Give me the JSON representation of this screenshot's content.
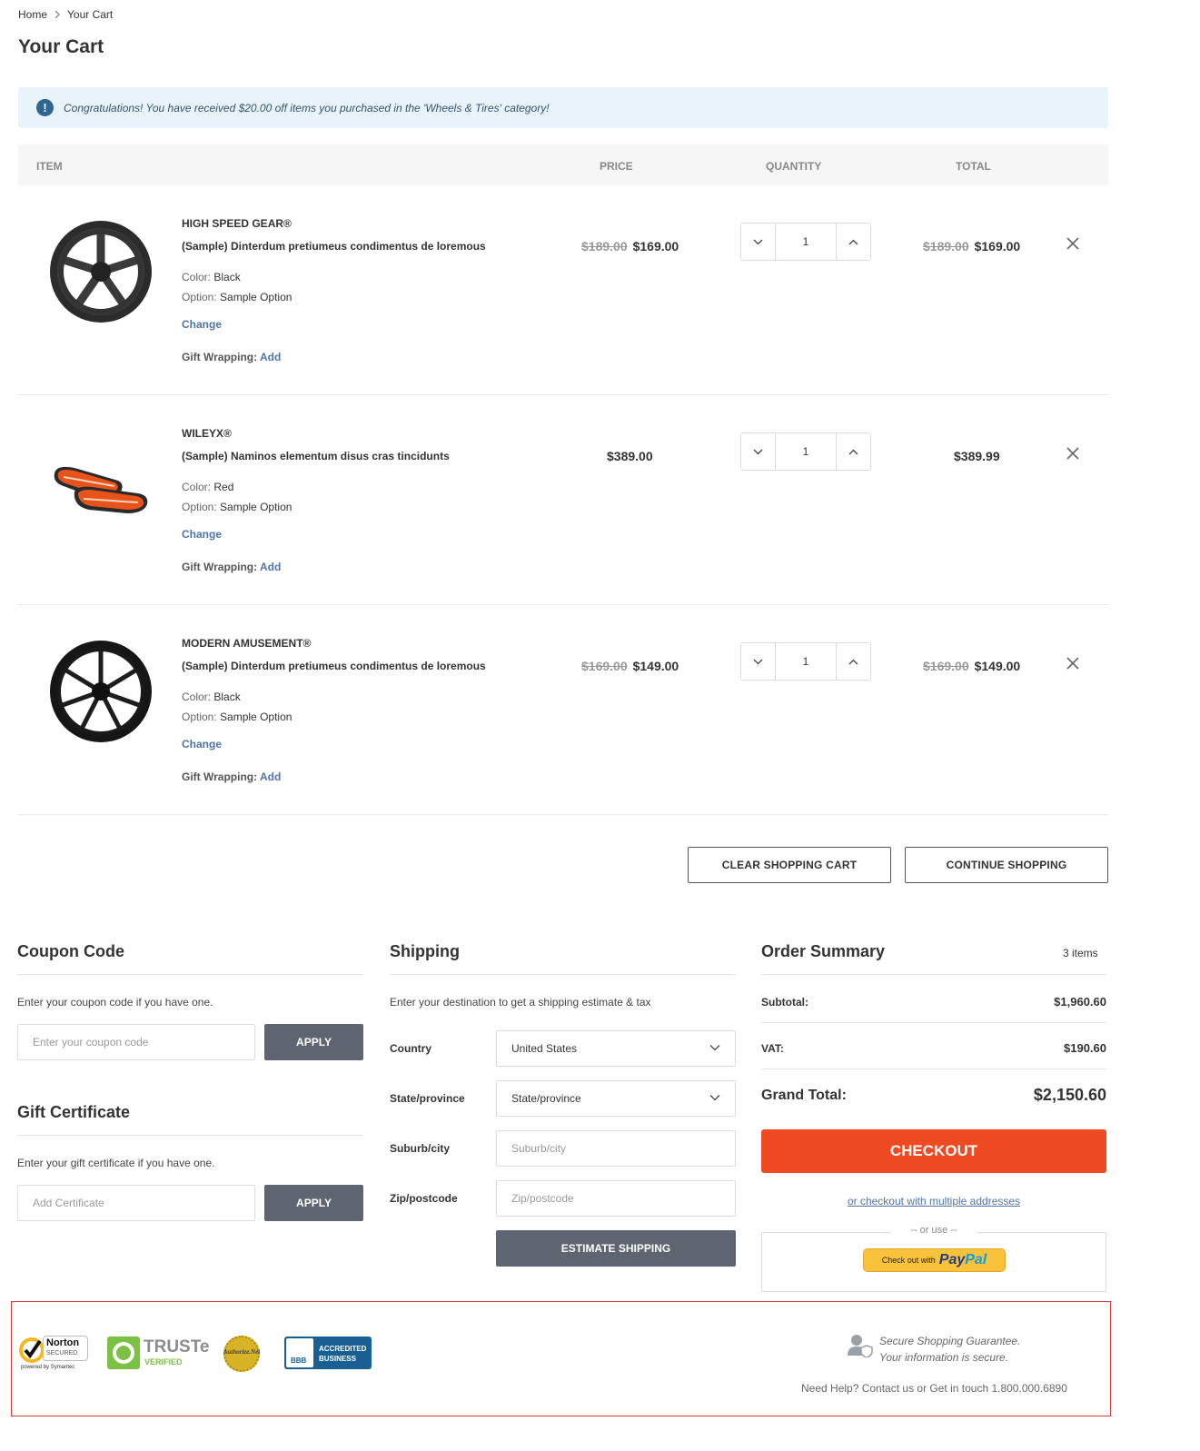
{
  "breadcrumb": {
    "home": "Home",
    "current": "Your Cart"
  },
  "page_title": "Your Cart",
  "alert": {
    "text": "Congratulations! You have received $20.00 off items you purchased in the 'Wheels & Tires' category!"
  },
  "table_headers": {
    "item": "ITEM",
    "price": "PRICE",
    "quantity": "QUANTITY",
    "total": "TOTAL"
  },
  "items": [
    {
      "brand": "HIGH SPEED GEAR®",
      "name": "(Sample) Dinterdum pretiumeus condimentus de loremous",
      "color_label": "Color:",
      "color": "Black",
      "option_label": "Option:",
      "option": "Sample Option",
      "change": "Change",
      "gift_label": "Gift Wrapping:",
      "gift_action": "Add",
      "price_old": "$189.00",
      "price": "$169.00",
      "qty": "1",
      "total_old": "$189.00",
      "total": "$169.00"
    },
    {
      "brand": "WILEYX®",
      "name": "(Sample) Naminos elementum disus cras tincidunts",
      "color_label": "Color:",
      "color": "Red",
      "option_label": "Option:",
      "option": "Sample Option",
      "change": "Change",
      "gift_label": "Gift Wrapping:",
      "gift_action": "Add",
      "price_old": "",
      "price": "$389.00",
      "qty": "1",
      "total_old": "",
      "total": "$389.99"
    },
    {
      "brand": "MODERN AMUSEMENT®",
      "name": "(Sample) Dinterdum pretiumeus condimentus de loremous",
      "color_label": "Color:",
      "color": "Black",
      "option_label": "Option:",
      "option": "Sample Option",
      "change": "Change",
      "gift_label": "Gift Wrapping:",
      "gift_action": "Add",
      "price_old": "$169.00",
      "price": "$149.00",
      "qty": "1",
      "total_old": "$169.00",
      "total": "$149.00"
    }
  ],
  "actions": {
    "clear": "CLEAR SHOPPING CART",
    "continue": "CONTINUE SHOPPING"
  },
  "coupon": {
    "title": "Coupon Code",
    "text": "Enter your coupon code if you have one.",
    "placeholder": "Enter your coupon code",
    "apply": "APPLY"
  },
  "gift_cert": {
    "title": "Gift Certificate",
    "text": "Enter your gift certificate if you have one.",
    "placeholder": "Add Certificate",
    "apply": "APPLY"
  },
  "shipping": {
    "title": "Shipping",
    "text": "Enter your destination to get a shipping estimate & tax",
    "country_label": "Country",
    "country_value": "United States",
    "state_label": "State/province",
    "state_value": "State/province",
    "city_label": "Suburb/city",
    "city_placeholder": "Suburb/city",
    "zip_label": "Zip/postcode",
    "zip_placeholder": "Zip/postcode",
    "estimate": "ESTIMATE SHIPPING"
  },
  "summary": {
    "title": "Order Summary",
    "count": "3 items",
    "subtotal_label": "Subtotal:",
    "subtotal": "$1,960.60",
    "vat_label": "VAT:",
    "vat": "$190.60",
    "grand_label": "Grand Total:",
    "grand": "$2,150.60",
    "checkout": "CHECKOUT",
    "multi": "or checkout with multiple addresses",
    "or_use": "-- or use --",
    "paypal_pre": "Check out with",
    "paypal_pay": "Pay",
    "paypal_pal": "Pal"
  },
  "trust": {
    "norton": "Norton",
    "norton_sub": "SECURED",
    "norton_powered": "powered by Symantec",
    "truste": "TRUSTe",
    "truste_sub": "VERIFIED",
    "authnet": "Authorize.Net",
    "bbb": "BBB",
    "bbb_line1": "ACCREDITED",
    "bbb_line2": "BUSINESS",
    "secure_line1": "Secure Shopping Guarantee.",
    "secure_line2": "Your information is secure.",
    "help": "Need Help? Contact us or Get in touch 1.800.000.6890"
  },
  "colors": {
    "accent": "#f04a22",
    "link": "#4f74a8",
    "button_dark": "#5e6570",
    "alert_bg": "#e8f3fa",
    "trust_border": "#d9393d"
  },
  "icons": [
    "info-icon",
    "chevron-right-icon",
    "chevron-down-icon",
    "chevron-up-icon",
    "close-icon",
    "user-shield-icon"
  ]
}
